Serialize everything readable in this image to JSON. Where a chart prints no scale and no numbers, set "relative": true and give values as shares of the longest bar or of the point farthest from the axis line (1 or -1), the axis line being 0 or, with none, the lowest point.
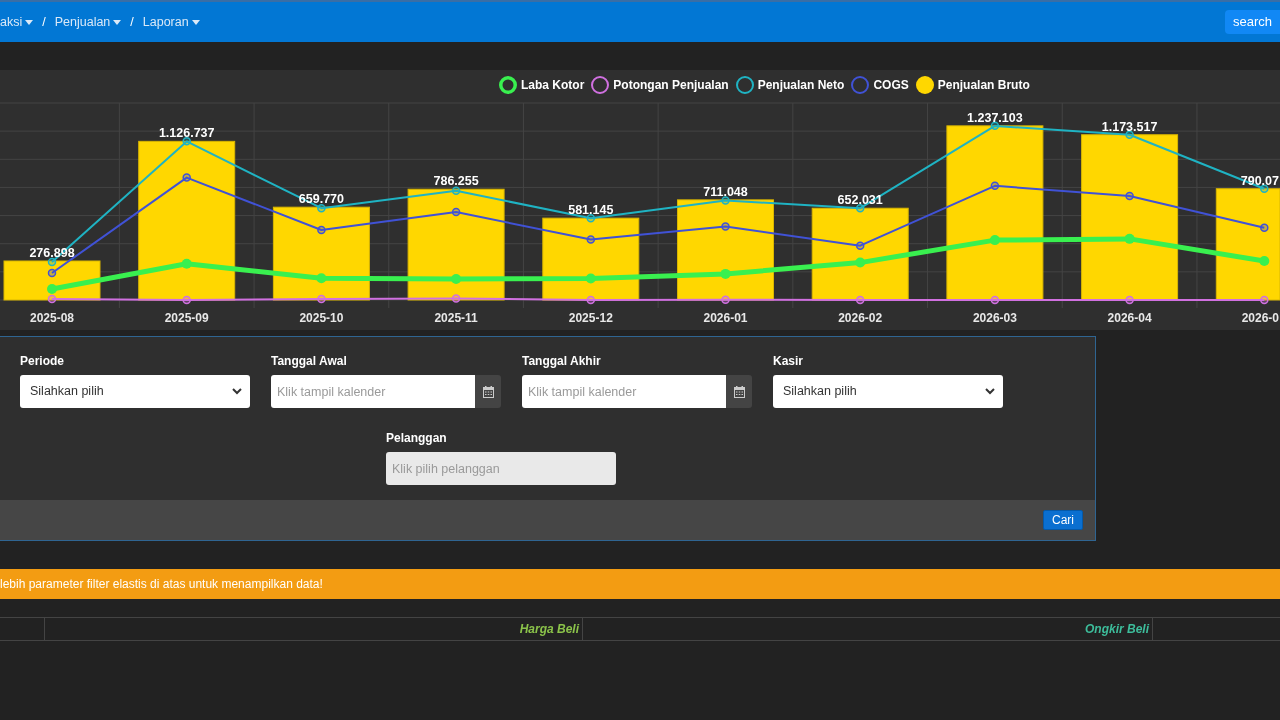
{
  "navbar": {
    "breadcrumb": [
      {
        "label": "aksi",
        "has_dropdown": true
      },
      {
        "separator": "/",
        "label": "Penjualan",
        "has_dropdown": true
      },
      {
        "separator": "/",
        "label": "Laporan",
        "has_dropdown": true
      }
    ],
    "search_button": "search"
  },
  "chart": {
    "chart_data": {
      "type": "bar",
      "relative": true,
      "categories": [
        "2025-08",
        "2025-09",
        "2025-10",
        "2025-11",
        "2025-12",
        "2026-01",
        "2026-02",
        "2026-03",
        "2026-04",
        "2026-0"
      ],
      "value_labels": [
        "276.898",
        "1.126.737",
        "659.770",
        "786.255",
        "581.145",
        "711.048",
        "652.031",
        "1.237.103",
        "1.173.517",
        "790.07"
      ],
      "series": [
        {
          "name": "Laba Kotor",
          "type": "line",
          "color": "#39f04f",
          "marker": "dot",
          "values": [
            0.063,
            0.208,
            0.125,
            0.121,
            0.123,
            0.15,
            0.215,
            0.344,
            0.351,
            0.224
          ]
        },
        {
          "name": "Potongan Penjualan",
          "type": "line",
          "color": "#d070e0",
          "marker": "circle",
          "values": [
            0.006,
            0,
            0.006,
            0.009,
            0,
            0.002,
            0,
            0,
            0,
            0
          ]
        },
        {
          "name": "Penjualan Neto",
          "type": "line",
          "color": "#1fb3c3",
          "marker": "circle",
          "values": [
            0.218,
            0.911,
            0.527,
            0.627,
            0.47,
            0.572,
            0.527,
            1,
            0.949,
            0.639
          ]
        },
        {
          "name": "COGS",
          "type": "line",
          "color": "#4052d6",
          "marker": "circle",
          "values": [
            0.155,
            0.703,
            0.402,
            0.505,
            0.347,
            0.422,
            0.312,
            0.656,
            0.597,
            0.415
          ]
        },
        {
          "name": "Penjualan Bruto",
          "type": "bar",
          "color": "#ffd700",
          "values": [
            0.224,
            0.911,
            0.533,
            0.636,
            0.47,
            0.575,
            0.527,
            1,
            0.949,
            0.639
          ]
        }
      ]
    }
  },
  "filter_form": {
    "rows": [
      [
        {
          "kind": "select",
          "label": "Periode",
          "value": "Silahkan pilih",
          "readonly": false
        },
        {
          "kind": "date",
          "label": "Tanggal Awal",
          "placeholder": "Klik tampil kalender",
          "readonly": false
        },
        {
          "kind": "date",
          "label": "Tanggal Akhir",
          "placeholder": "Klik tampil kalender",
          "readonly": false
        },
        {
          "kind": "select",
          "label": "Kasir",
          "value": "Silahkan pilih",
          "readonly": false
        }
      ],
      [
        {
          "kind": "text",
          "label": "Pelanggan",
          "placeholder": "Klik pilih pelanggan",
          "readonly": true
        }
      ]
    ],
    "submit_button": "Cari"
  },
  "alert": {
    "text": "lebih parameter filter elastis di atas untuk menampilkan data!"
  },
  "table": {
    "columns": [
      {
        "label": "Harga Beli",
        "color": "#8bc34a"
      },
      {
        "label": "Ongkir Beli",
        "color": "#3dbd9b"
      }
    ]
  }
}
